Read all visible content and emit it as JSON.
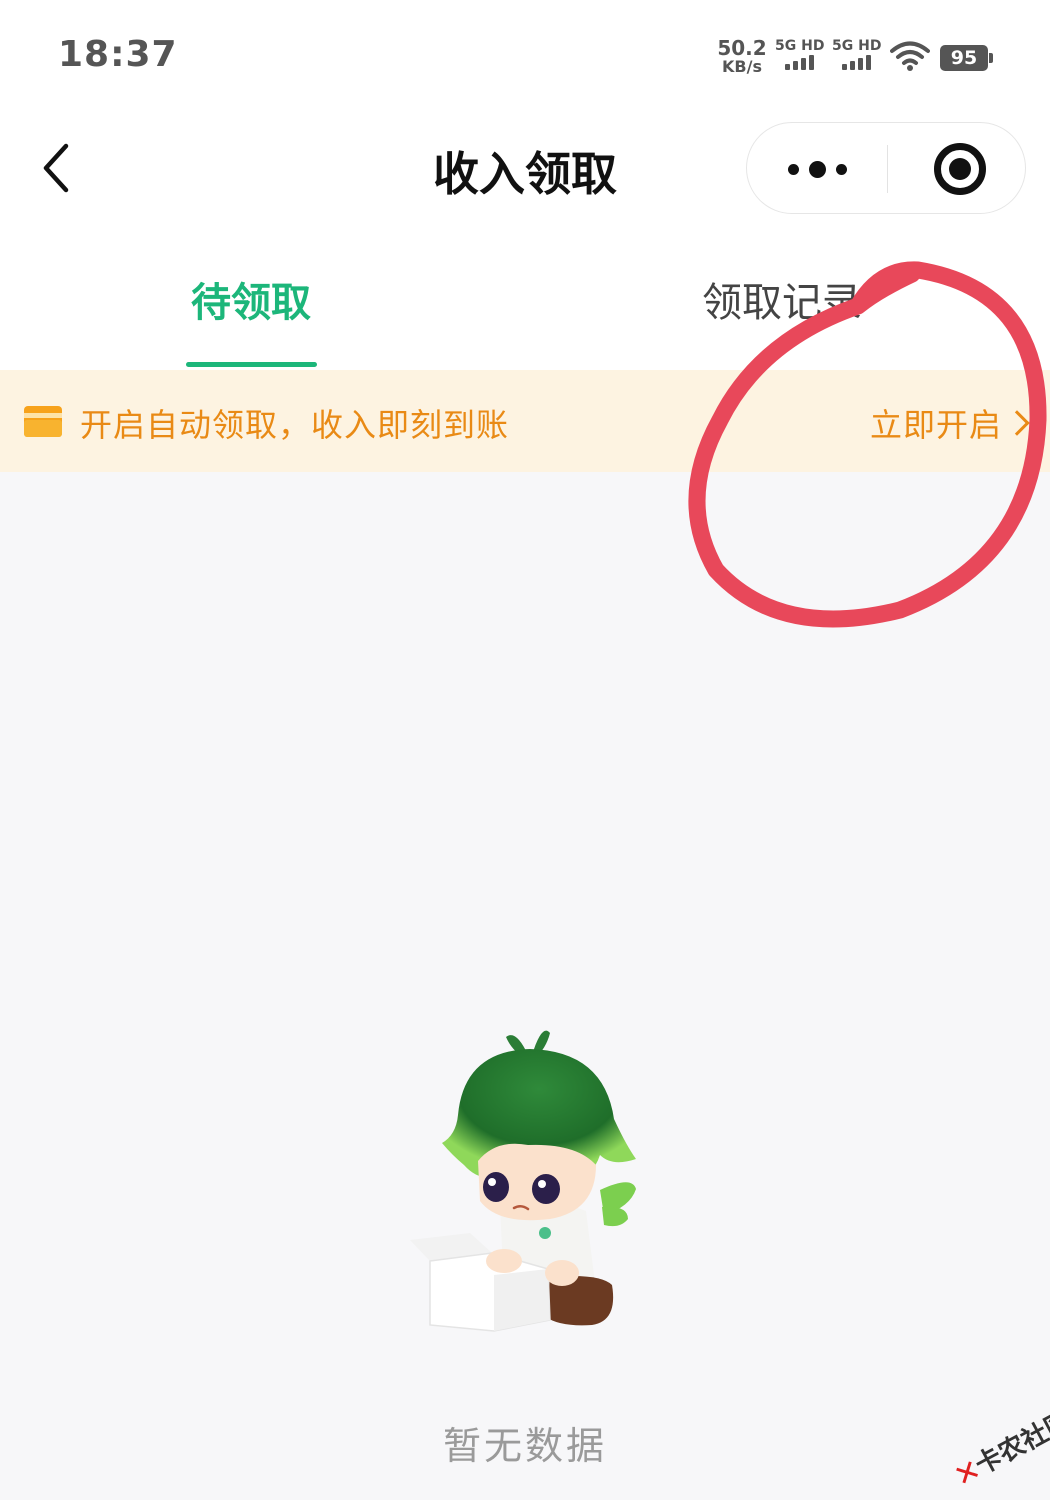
{
  "status_bar": {
    "time": "18:37",
    "net_speed_value": "50.2",
    "net_speed_unit": "KB/s",
    "sim1_label": "5G HD",
    "sim2_label": "5G HD",
    "battery": "95"
  },
  "nav": {
    "title": "收入领取",
    "back_icon": "chevron-left-icon",
    "more_icon": "more-dots-icon",
    "close_icon": "target-close-icon"
  },
  "tabs": [
    {
      "label": "待领取",
      "active": true
    },
    {
      "label": "领取记录",
      "active": false
    }
  ],
  "banner": {
    "icon": "wallet-icon",
    "text": "开启自动领取，收入即刻到账",
    "action": "立即开启"
  },
  "empty_state": {
    "illustration": "green-haired-mascot-with-box",
    "text": "暂无数据"
  },
  "watermark": {
    "text": "卡农社区"
  },
  "colors": {
    "accent_green": "#1cb67a",
    "banner_bg": "#fdf3e1",
    "banner_text": "#e98a15",
    "annotation_red": "#e8485a"
  }
}
